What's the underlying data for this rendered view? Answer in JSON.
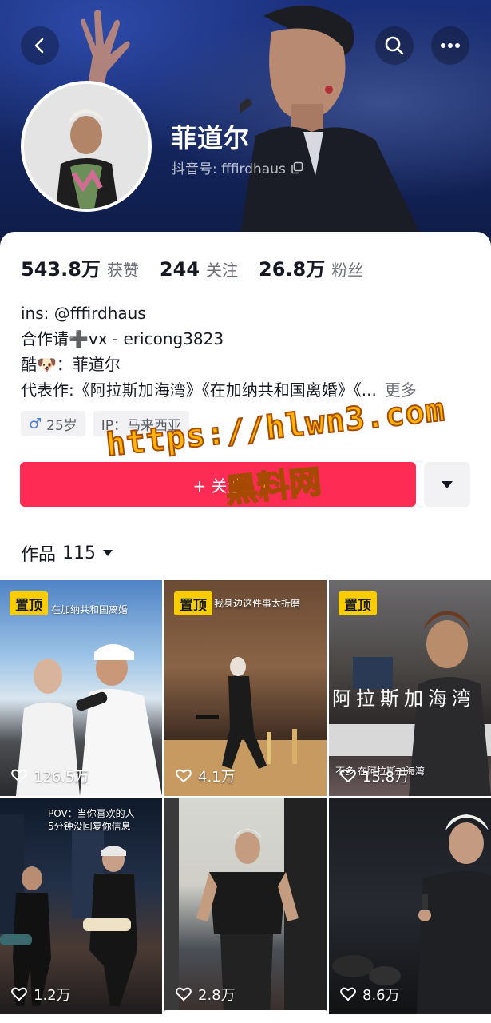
{
  "profile": {
    "name": "菲道尔",
    "id_label": "抖音号: fffirdhaus"
  },
  "stats": [
    {
      "num": "543.8万",
      "label": "获赞"
    },
    {
      "num": "244",
      "label": "关注"
    },
    {
      "num": "26.8万",
      "label": "粉丝"
    }
  ],
  "bio": {
    "line1": "ins: @fffirdhaus",
    "line2": "合作请➕vx - ericong3823",
    "line3": "酷🐶：菲道尔",
    "line4": "代表作:《阿拉斯加海湾》《在加纳共和国离婚》《...",
    "more": "更多"
  },
  "tags": {
    "gender_age": "25岁",
    "ip": "IP：马来西亚"
  },
  "follow": {
    "label": "+ 关注"
  },
  "watermark": {
    "line1": "https://hlwn3.com",
    "line2": "黑料网"
  },
  "works": {
    "label": "作品",
    "count": "115"
  },
  "videos": [
    {
      "pinned": "置顶",
      "likes": "126.5万",
      "overlay": "在加纳共和国离婚"
    },
    {
      "pinned": "置顶",
      "likes": "4.1万",
      "overlay": "我身边这件事太折磨"
    },
    {
      "pinned": "置顶",
      "likes": "15.8万",
      "overlay": "阿拉斯加海湾",
      "overlay2": "不多 在阿拉斯加海湾"
    },
    {
      "likes": "1.2万",
      "overlay": "POV：当你喜欢的人",
      "overlay2": "5分钟没回复你信息"
    },
    {
      "likes": "2.8万"
    },
    {
      "likes": "8.6万"
    }
  ],
  "colors": {
    "accent": "#fe2c55",
    "pinned": "#facd00",
    "banner": "#1a2f7a"
  },
  "icons": {
    "back": "chevron-left-icon",
    "search": "search-icon",
    "more": "more-horizontal-icon",
    "copy": "copy-icon",
    "dropdown": "caret-down-icon",
    "heart": "heart-outline-icon",
    "male": "male-icon"
  }
}
